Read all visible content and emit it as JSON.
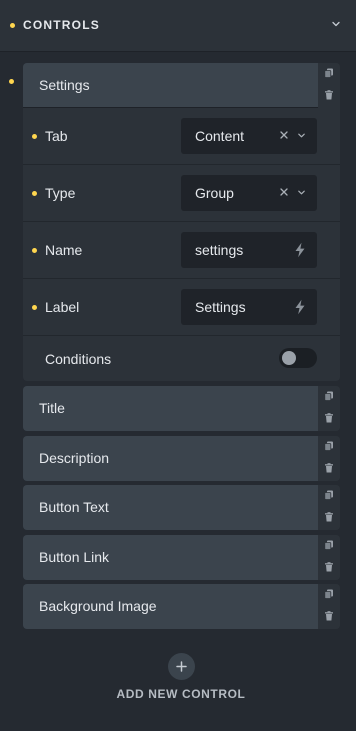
{
  "header": {
    "title": "CONTROLS"
  },
  "group": {
    "title": "Settings",
    "fields": [
      {
        "label": "Tab",
        "value": "Content",
        "type": "select"
      },
      {
        "label": "Type",
        "value": "Group",
        "type": "select"
      },
      {
        "label": "Name",
        "value": "settings",
        "type": "dynamic"
      },
      {
        "label": "Label",
        "value": "Settings",
        "type": "dynamic"
      }
    ],
    "conditions": {
      "label": "Conditions",
      "enabled": false
    }
  },
  "controls": [
    {
      "label": "Title"
    },
    {
      "label": "Description"
    },
    {
      "label": "Button Text"
    },
    {
      "label": "Button Link"
    },
    {
      "label": "Background Image"
    }
  ],
  "add": {
    "label": "ADD NEW CONTROL"
  },
  "colors": {
    "accent_dot": "#ffd64f",
    "panel": "#2c3239",
    "item": "#3b444d",
    "input": "#1f2329"
  }
}
